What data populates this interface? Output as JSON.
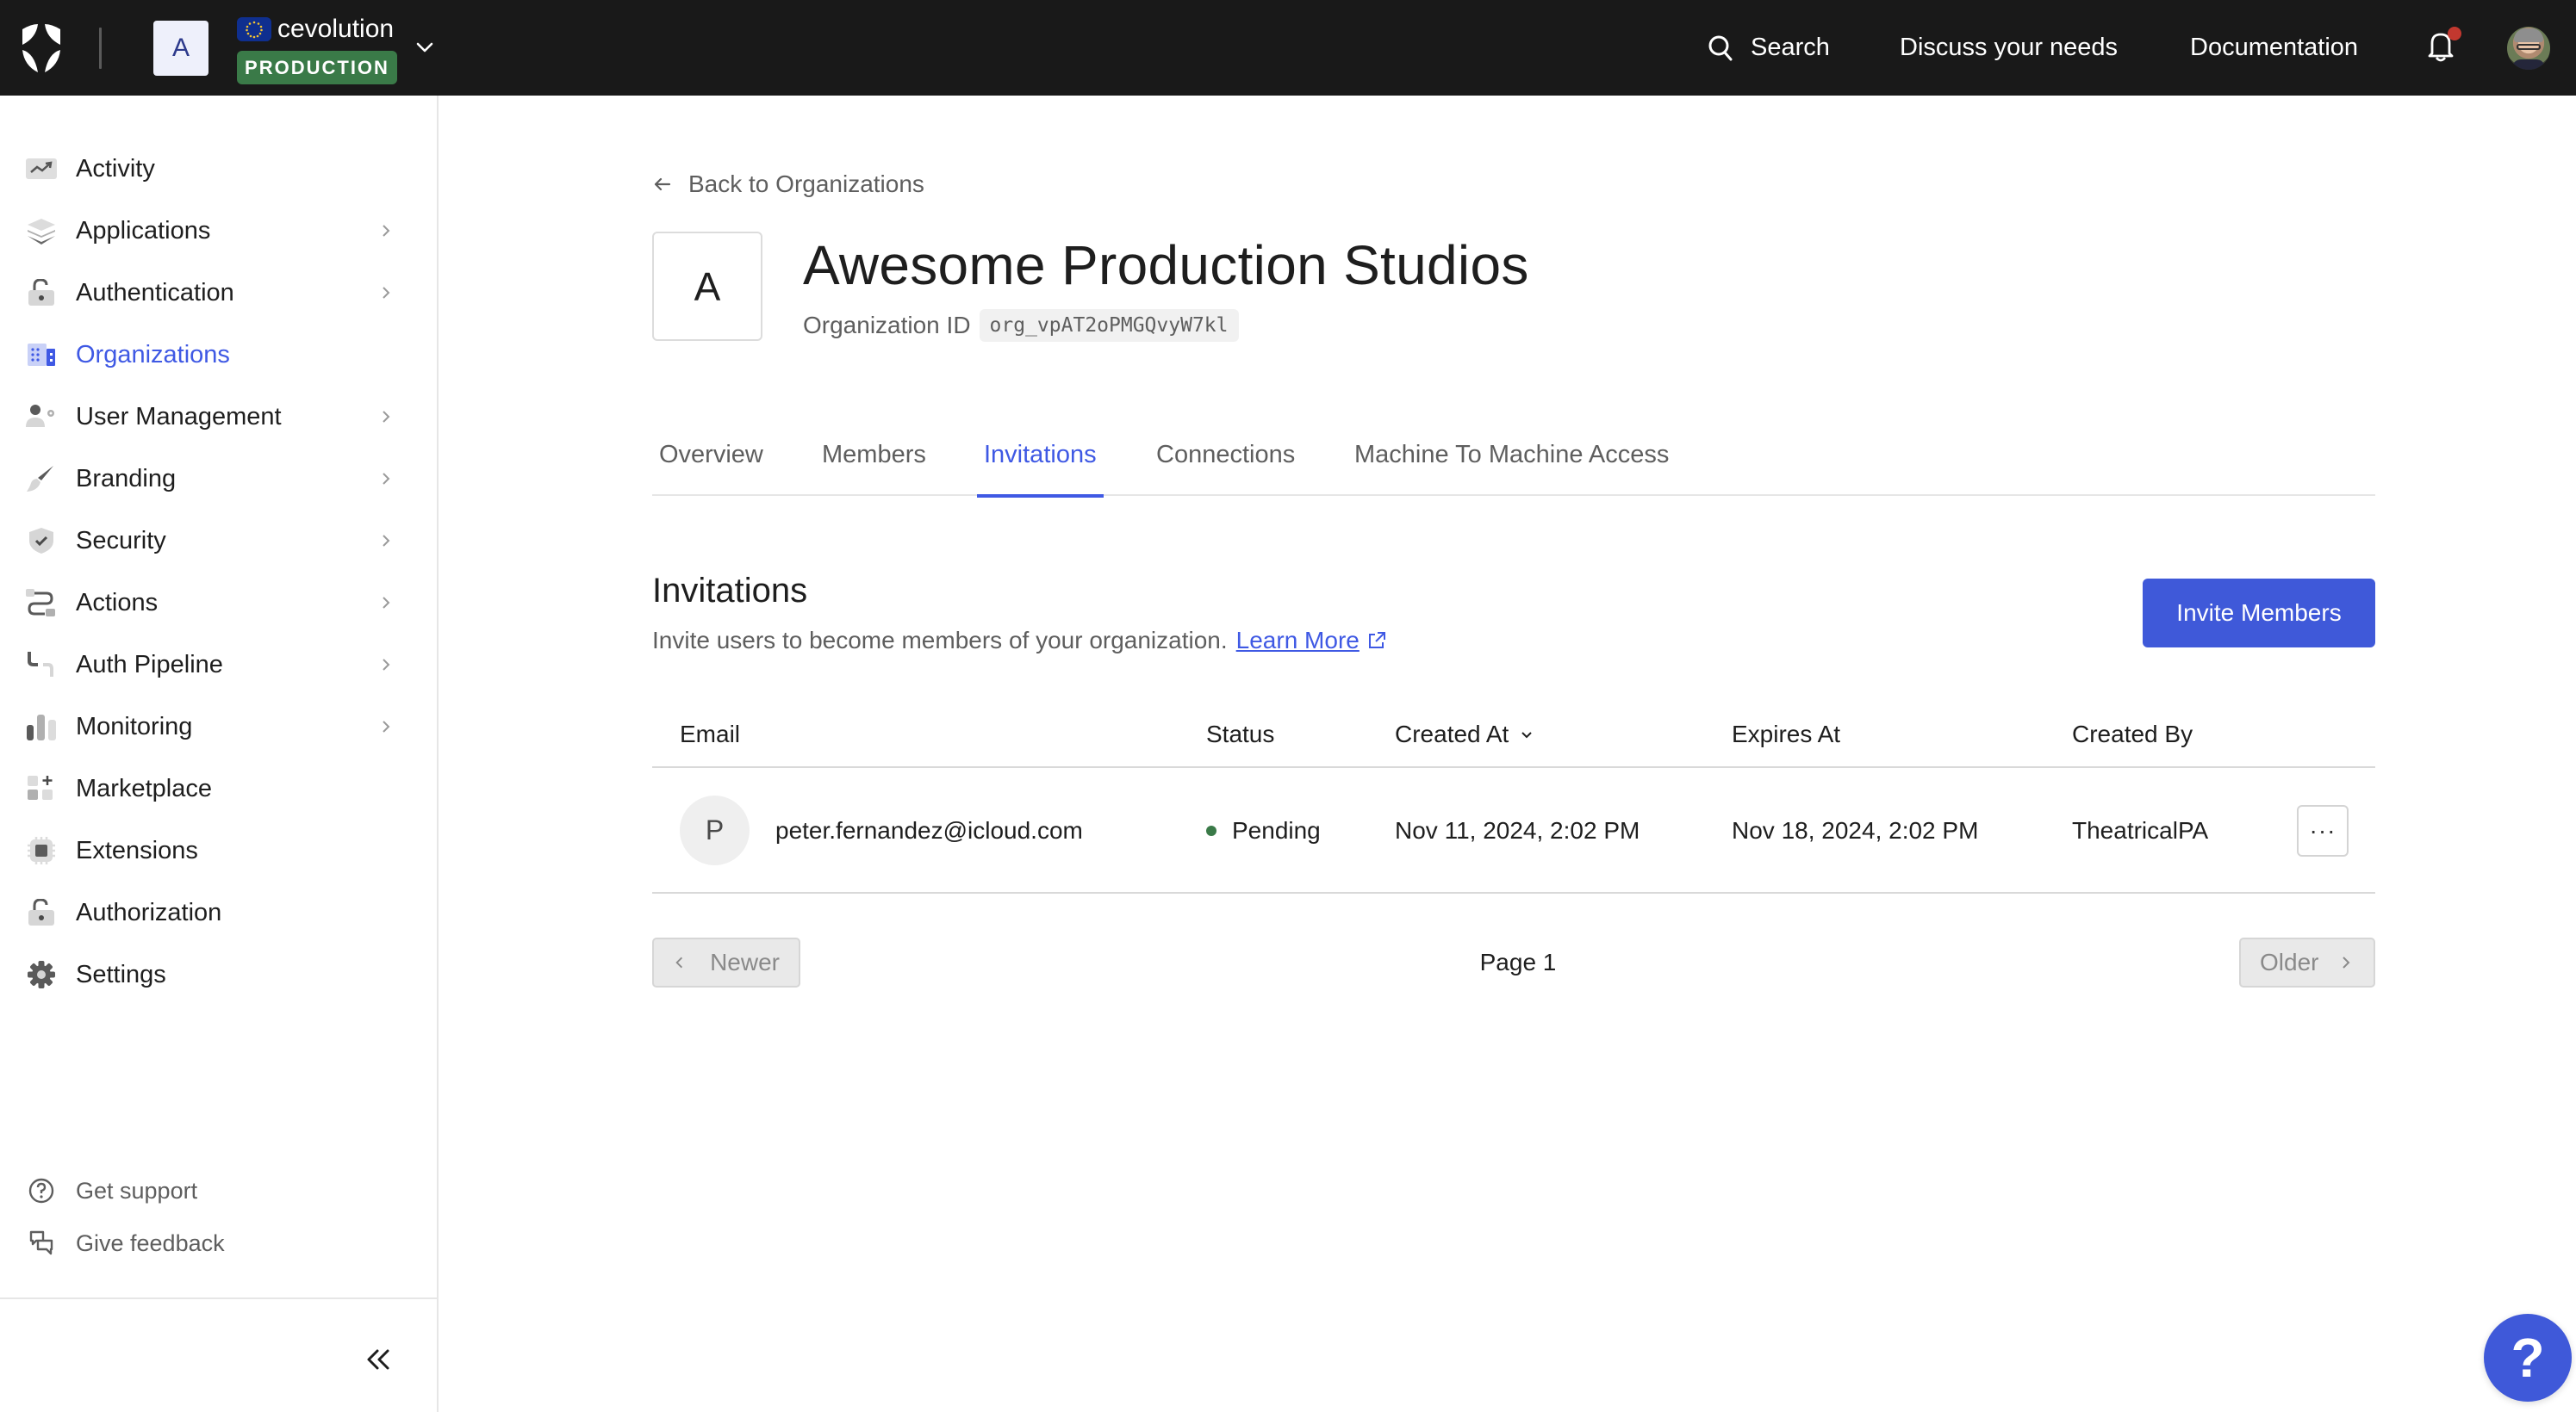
{
  "topbar": {
    "logo_icon": "shield-logo-icon",
    "tenant_initial": "A",
    "tenant_region_icon": "eu-flag-icon",
    "tenant_name": "cevolution",
    "environment_badge": "PRODUCTION",
    "search_label": "Search",
    "discuss_label": "Discuss your needs",
    "docs_label": "Documentation",
    "notifications_icon": "bell-icon",
    "has_unread_notifications": true
  },
  "sidebar": {
    "items": [
      {
        "label": "Activity",
        "icon": "activity-icon",
        "has_children": false,
        "active": false
      },
      {
        "label": "Applications",
        "icon": "layers-icon",
        "has_children": true,
        "active": false
      },
      {
        "label": "Authentication",
        "icon": "unlock-icon",
        "has_children": true,
        "active": false
      },
      {
        "label": "Organizations",
        "icon": "building-icon",
        "has_children": false,
        "active": true
      },
      {
        "label": "User Management",
        "icon": "user-gear-icon",
        "has_children": true,
        "active": false
      },
      {
        "label": "Branding",
        "icon": "brush-icon",
        "has_children": true,
        "active": false
      },
      {
        "label": "Security",
        "icon": "shield-check-icon",
        "has_children": true,
        "active": false
      },
      {
        "label": "Actions",
        "icon": "flow-icon",
        "has_children": true,
        "active": false
      },
      {
        "label": "Auth Pipeline",
        "icon": "pipe-icon",
        "has_children": true,
        "active": false
      },
      {
        "label": "Monitoring",
        "icon": "bar-chart-icon",
        "has_children": true,
        "active": false
      },
      {
        "label": "Marketplace",
        "icon": "grid-plus-icon",
        "has_children": false,
        "active": false
      },
      {
        "label": "Extensions",
        "icon": "chip-icon",
        "has_children": false,
        "active": false
      },
      {
        "label": "Authorization",
        "icon": "unlock-icon",
        "has_children": false,
        "active": false
      },
      {
        "label": "Settings",
        "icon": "gear-icon",
        "has_children": false,
        "active": false
      }
    ],
    "footer": [
      {
        "label": "Get support",
        "icon": "question-circle-icon"
      },
      {
        "label": "Give feedback",
        "icon": "chat-bubbles-icon"
      }
    ],
    "collapse_icon": "double-chevron-left-icon"
  },
  "main": {
    "back_link": "Back to Organizations",
    "org_initial": "A",
    "org_name": "Awesome Production Studios",
    "org_id_label": "Organization ID",
    "org_id": "org_vpAT2oPMGQvyW7kl",
    "tabs": [
      {
        "label": "Overview",
        "active": false
      },
      {
        "label": "Members",
        "active": false
      },
      {
        "label": "Invitations",
        "active": true
      },
      {
        "label": "Connections",
        "active": false
      },
      {
        "label": "Machine To Machine Access",
        "active": false
      }
    ],
    "section": {
      "title": "Invitations",
      "description": "Invite users to become members of your organization.",
      "learn_more": "Learn More",
      "invite_button": "Invite Members"
    },
    "table": {
      "columns": [
        "Email",
        "Status",
        "Created At",
        "Expires At",
        "Created By"
      ],
      "sorted_column": "Created At",
      "rows": [
        {
          "initial": "P",
          "email": "peter.fernandez@icloud.com",
          "status": "Pending",
          "created_at": "Nov 11, 2024, 2:02 PM",
          "expires_at": "Nov 18, 2024, 2:02 PM",
          "created_by": "TheatricalPA",
          "more": "···"
        }
      ]
    },
    "pagination": {
      "newer": "Newer",
      "page": "Page 1",
      "older": "Older"
    }
  },
  "colors": {
    "accent": "#3f59e4",
    "topbar_bg": "#191919",
    "env_badge": "#3a7a48",
    "status_pending": "#3a7a48",
    "notification_dot": "#c2382f"
  },
  "help_bubble": "?"
}
